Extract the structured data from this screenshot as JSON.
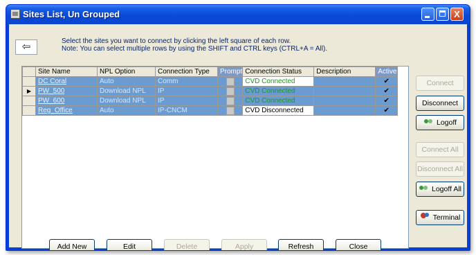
{
  "window": {
    "title": "Sites List, Un Grouped",
    "close_glyph": "X"
  },
  "instructions": {
    "line1": "Select the sites you want to connect by clicking the left square of each row.",
    "line2": "Note: You can select multiple rows by using the SHIFT and CTRL keys  (CTRL+A = All)."
  },
  "back_button": {
    "icon": "back-arrow-icon",
    "glyph": "⇦"
  },
  "grid": {
    "columns": [
      "Site Name",
      "NPL Option",
      "Connection Type",
      "Prompt",
      "Connection Status",
      "Description",
      "Active"
    ],
    "rows": [
      {
        "site": "DC Coral",
        "npl": "Auto",
        "type": "Comm",
        "status": "CVD Connected",
        "description": "",
        "active": "✔",
        "current": false
      },
      {
        "site": "PW_500",
        "npl": "Download NPL",
        "type": "IP",
        "status": "CVD Connected",
        "description": "",
        "active": "✔",
        "current": true
      },
      {
        "site": "PW_600",
        "npl": "Download NPL",
        "type": "IP",
        "status": "CVD Connected",
        "description": "",
        "active": "✔",
        "current": false
      },
      {
        "site": "Reg_Office",
        "npl": "Auto",
        "type": "IP-CNCM",
        "status": "CVD Disconnected",
        "description": "",
        "active": "✔",
        "current": false
      }
    ],
    "row_pointer_glyph": "▶"
  },
  "side_buttons": {
    "connect": "Connect",
    "disconnect": "Disconnect",
    "logoff": "Logoff",
    "connect_all": "Connect All",
    "disconnect_all": "Disconnect All",
    "logoff_all": "Logoff All",
    "terminal": "Terminal"
  },
  "bottom_buttons": {
    "add_new": "Add New",
    "edit": "Edit",
    "delete": "Delete",
    "apply": "Apply",
    "refresh": "Refresh",
    "close": "Close"
  },
  "colors": {
    "selected_row": "#6a9bd1",
    "connected_text": "#1b9a1b",
    "title_bar": "#0a4ad8"
  }
}
